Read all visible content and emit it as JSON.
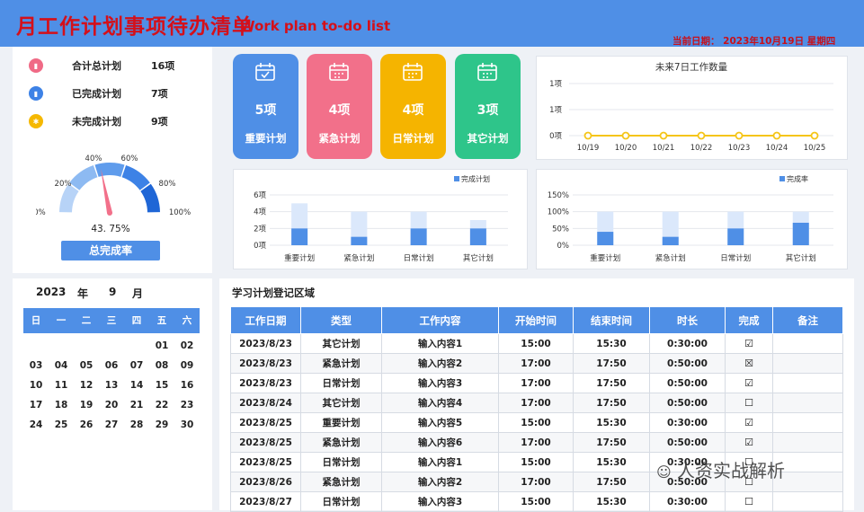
{
  "header": {
    "title_cn": "月工作计划事项待办清单",
    "title_en": "Work plan to-do list",
    "date_label": "当前日期：",
    "date_value": "2023年10月19日 星期四"
  },
  "summary": {
    "items": [
      {
        "label": "合计总计划",
        "value": "16项",
        "color": "#f06a86",
        "icon": "bar-chart-icon"
      },
      {
        "label": "已完成计划",
        "value": "7项",
        "color": "#3d82e6",
        "icon": "bar-chart-icon"
      },
      {
        "label": "未完成计划",
        "value": "9项",
        "color": "#f5b800",
        "icon": "gear-icon"
      }
    ],
    "gauge_ticks": [
      "0%",
      "20%",
      "40%",
      "60%",
      "80%",
      "100%"
    ],
    "gauge_value": "43. 75%",
    "gauge_fraction": 0.4375,
    "rate_button": "总完成率"
  },
  "cards": [
    {
      "num": "5项",
      "label": "重要计划",
      "color": "#4f8fe6",
      "icon": "calendar-check-icon"
    },
    {
      "num": "4项",
      "label": "紧急计划",
      "color": "#f2708a",
      "icon": "calendar-grid-icon"
    },
    {
      "num": "4项",
      "label": "日常计划",
      "color": "#f5b400",
      "icon": "calendar-grid-icon"
    },
    {
      "num": "3项",
      "label": "其它计划",
      "color": "#2ec58a",
      "icon": "calendar-settings-icon"
    }
  ],
  "chart_data": [
    {
      "type": "line",
      "title": "未来7日工作数量",
      "categories": [
        "10/19",
        "10/20",
        "10/21",
        "10/22",
        "10/23",
        "10/24",
        "10/25"
      ],
      "values": [
        0,
        0,
        0,
        0,
        0,
        0,
        0
      ],
      "yticks": [
        "0项",
        "1项",
        "1项"
      ],
      "ylim": [
        0,
        1
      ],
      "grid": true,
      "line_color": "#f5c518"
    },
    {
      "type": "bar",
      "legend": "完成计划",
      "legend_position": "top-right",
      "categories": [
        "重要计划",
        "紧急计划",
        "日常计划",
        "其它计划"
      ],
      "totals": [
        5,
        4,
        4,
        3
      ],
      "values": [
        2,
        1,
        2,
        2
      ],
      "yticks": [
        "0项",
        "2项",
        "4项",
        "6项"
      ],
      "ylim": [
        0,
        6
      ],
      "grid": true
    },
    {
      "type": "bar",
      "legend": "完成率",
      "legend_position": "top-right",
      "categories": [
        "重要计划",
        "紧急计划",
        "日常计划",
        "其它计划"
      ],
      "totals": [
        100,
        100,
        100,
        100
      ],
      "values": [
        40,
        25,
        50,
        67
      ],
      "yticks": [
        "0%",
        "50%",
        "100%",
        "150%"
      ],
      "ylim": [
        0,
        150
      ],
      "grid": true
    }
  ],
  "calendar": {
    "year": "2023",
    "year_unit": "年",
    "month": "9",
    "month_unit": "月",
    "weekdays": [
      "日",
      "一",
      "二",
      "三",
      "四",
      "五",
      "六"
    ],
    "weeks": [
      [
        "",
        "",
        "",
        "",
        "",
        "01",
        "02"
      ],
      [
        "03",
        "04",
        "05",
        "06",
        "07",
        "08",
        "09"
      ],
      [
        "10",
        "11",
        "12",
        "13",
        "14",
        "15",
        "16"
      ],
      [
        "17",
        "18",
        "19",
        "20",
        "21",
        "22",
        "23"
      ],
      [
        "24",
        "25",
        "26",
        "27",
        "28",
        "29",
        "30"
      ]
    ]
  },
  "tasks": {
    "section_title": "学习计划登记区域",
    "columns": [
      "工作日期",
      "类型",
      "工作内容",
      "开始时间",
      "结束时间",
      "时长",
      "完成",
      "备注"
    ],
    "rows": [
      [
        "2023/8/23",
        "其它计划",
        "输入内容1",
        "15:00",
        "15:30",
        "0:30:00",
        "☑",
        ""
      ],
      [
        "2023/8/23",
        "紧急计划",
        "输入内容2",
        "17:00",
        "17:50",
        "0:50:00",
        "☒",
        ""
      ],
      [
        "2023/8/23",
        "日常计划",
        "输入内容3",
        "17:00",
        "17:50",
        "0:50:00",
        "☑",
        ""
      ],
      [
        "2023/8/24",
        "其它计划",
        "输入内容4",
        "17:00",
        "17:50",
        "0:50:00",
        "☐",
        ""
      ],
      [
        "2023/8/25",
        "重要计划",
        "输入内容5",
        "15:00",
        "15:30",
        "0:30:00",
        "☑",
        ""
      ],
      [
        "2023/8/25",
        "紧急计划",
        "输入内容6",
        "17:00",
        "17:50",
        "0:50:00",
        "☑",
        ""
      ],
      [
        "2023/8/25",
        "日常计划",
        "输入内容1",
        "15:00",
        "15:30",
        "0:30:00",
        "☐",
        ""
      ],
      [
        "2023/8/26",
        "紧急计划",
        "输入内容2",
        "17:00",
        "17:50",
        "0:50:00",
        "☐",
        ""
      ],
      [
        "2023/8/27",
        "日常计划",
        "输入内容3",
        "15:00",
        "15:30",
        "0:30:00",
        "☐",
        ""
      ]
    ]
  },
  "watermark": "人资实战解析"
}
